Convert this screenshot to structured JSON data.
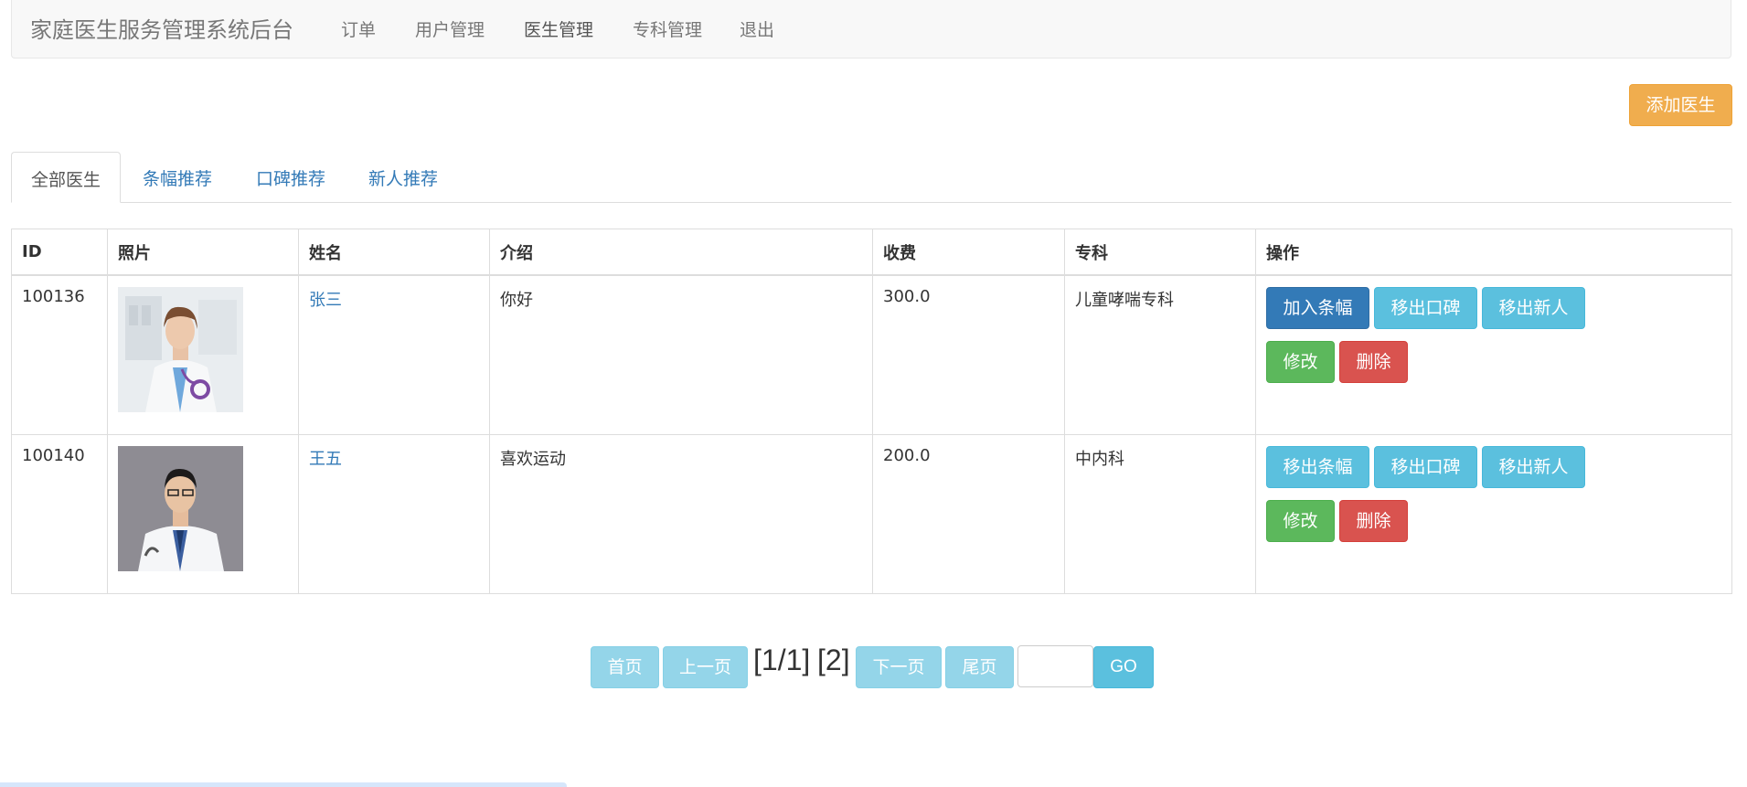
{
  "nav": {
    "brand": "家庭医生服务管理系统后台",
    "items": [
      "订单",
      "用户管理",
      "医生管理",
      "专科管理",
      "退出"
    ]
  },
  "toolbar": {
    "add_doctor_label": "添加医生"
  },
  "tabs": [
    "全部医生",
    "条幅推荐",
    "口碑推荐",
    "新人推荐"
  ],
  "table": {
    "headers": [
      "ID",
      "照片",
      "姓名",
      "介绍",
      "收费",
      "专科",
      "操作"
    ],
    "rows": [
      {
        "id": "100136",
        "name": "张三",
        "intro": "你好",
        "fee": "300.0",
        "specialty": "儿童哮喘专科",
        "actions": [
          "加入条幅",
          "移出口碑",
          "移出新人",
          "修改",
          "删除"
        ]
      },
      {
        "id": "100140",
        "name": "王五",
        "intro": "喜欢运动",
        "fee": "200.0",
        "specialty": "中内科",
        "actions": [
          "移出条幅",
          "移出口碑",
          "移出新人",
          "修改",
          "删除"
        ]
      }
    ]
  },
  "pagination": {
    "first": "首页",
    "prev": "上一页",
    "page_info": "[1/1]",
    "total": "[2]",
    "next": "下一页",
    "last": "尾页",
    "page_input": "",
    "go": "GO"
  },
  "colors": {
    "primary": "#337ab7",
    "info": "#5bc0de",
    "success": "#5cb85c",
    "danger": "#d9534f",
    "warning": "#f0ad4e"
  }
}
